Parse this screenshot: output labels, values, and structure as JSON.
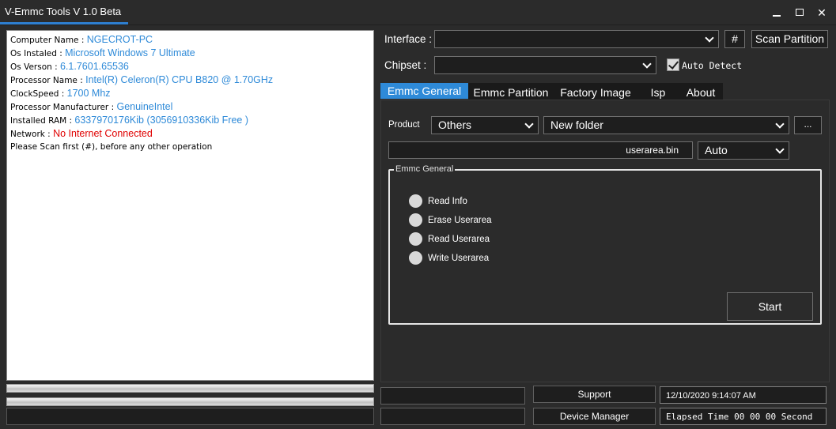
{
  "window": {
    "title": "V-Emmc Tools V 1.0 Beta",
    "controls": {
      "minimize": "minimize-icon",
      "maximize": "maximize-icon",
      "close": "✕"
    }
  },
  "info": {
    "lines": [
      {
        "label": "Computer Name : ",
        "value": "NGECROT-PC",
        "value_color": "#2e8ad8"
      },
      {
        "label": "Os Instaled : ",
        "value": "Microsoft Windows 7 Ultimate",
        "value_color": "#2e8ad8"
      },
      {
        "label": "Os Verson : ",
        "value": "6.1.7601.65536",
        "value_color": "#2e8ad8"
      },
      {
        "label": "Processor Name : ",
        "value": "Intel(R) Celeron(R) CPU B820 @ 1.70GHz",
        "value_color": "#2e8ad8"
      },
      {
        "label": "ClockSpeed : ",
        "value": "1700 Mhz",
        "value_color": "#2e8ad8"
      },
      {
        "label": "Processor Manufacturer : ",
        "value": "GenuineIntel",
        "value_color": "#2e8ad8"
      },
      {
        "label": "Installed RAM : ",
        "value": "6337970176Kib (3056910336Kib Free )",
        "value_color": "#2e8ad8"
      },
      {
        "label": "Network : ",
        "value": "No Internet Connected",
        "value_color": "#e00000"
      },
      {
        "label": "Please Scan first (#), before any other operation",
        "value": "",
        "value_color": "#2e8ad8"
      }
    ]
  },
  "top": {
    "interface_label": "Interface :",
    "interface_value": "",
    "hash_button": "#",
    "scan_button": "Scan Partition",
    "chipset_label": "Chipset :",
    "chipset_value": "",
    "auto_detect_label": "Auto Detect",
    "auto_detect_checked": true
  },
  "tabs": [
    {
      "label": "Emmc General",
      "active": true
    },
    {
      "label": "Emmc Partition",
      "active": false
    },
    {
      "label": "Factory Image",
      "active": false
    },
    {
      "label": "Isp",
      "active": false
    },
    {
      "label": "About",
      "active": false
    }
  ],
  "general": {
    "product_label": "Product",
    "product_value": "Others",
    "folder_value": "New folder",
    "browse_button": "...",
    "file_value": "userarea.bin",
    "mode_value": "Auto",
    "group_title": "Emmc General",
    "options": [
      "Read Info",
      "Erase Userarea",
      "Read Userarea",
      "Write Userarea"
    ],
    "start_button": "Start"
  },
  "bottom": {
    "support_button": "Support",
    "device_manager_button": "Device Manager",
    "datetime": "12/10/2020 9:14:07 AM",
    "elapsed": "Elapsed Time 00 00 00 Second"
  },
  "colors": {
    "accent": "#2e8ad8",
    "background": "#2b2b2b",
    "field": "#1e1e1e",
    "error": "#e00000"
  }
}
